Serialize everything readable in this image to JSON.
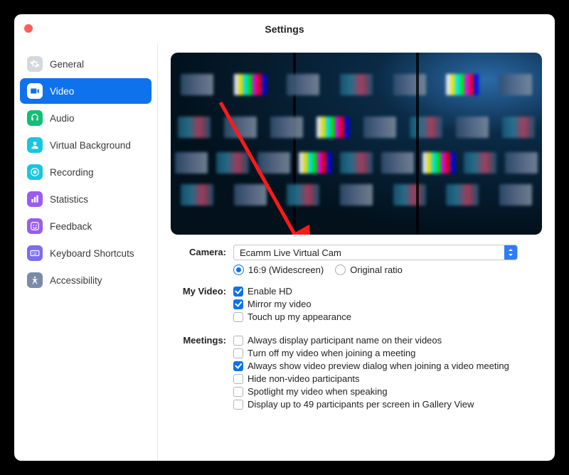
{
  "window": {
    "title": "Settings"
  },
  "sidebar": {
    "items": [
      {
        "label": "General",
        "icon": "gear",
        "bg": "#d5d8dc",
        "fg": "#fff"
      },
      {
        "label": "Video",
        "icon": "camera",
        "bg": "#ffffff",
        "fg": "#0e72ed",
        "active": true
      },
      {
        "label": "Audio",
        "icon": "headset",
        "bg": "#10c074",
        "fg": "#fff"
      },
      {
        "label": "Virtual Background",
        "icon": "user",
        "bg": "#18c6e0",
        "fg": "#fff"
      },
      {
        "label": "Recording",
        "icon": "record",
        "bg": "#18c6e0",
        "fg": "#fff"
      },
      {
        "label": "Statistics",
        "icon": "stats",
        "bg": "#9a5cf0",
        "fg": "#fff"
      },
      {
        "label": "Feedback",
        "icon": "smile",
        "bg": "#9a5cf0",
        "fg": "#fff"
      },
      {
        "label": "Keyboard Shortcuts",
        "icon": "keyboard",
        "bg": "#7b6cf0",
        "fg": "#fff"
      },
      {
        "label": "Accessibility",
        "icon": "access",
        "bg": "#7b8aa8",
        "fg": "#fff"
      }
    ]
  },
  "camera": {
    "label": "Camera:",
    "selected": "Ecamm Live Virtual Cam",
    "aspect_16_9": "16:9 (Widescreen)",
    "aspect_orig": "Original ratio"
  },
  "myvideo": {
    "label": "My Video:",
    "options": [
      {
        "label": "Enable HD",
        "checked": true
      },
      {
        "label": "Mirror my video",
        "checked": true
      },
      {
        "label": "Touch up my appearance",
        "checked": false
      }
    ]
  },
  "meetings": {
    "label": "Meetings:",
    "options": [
      {
        "label": "Always display participant name on their videos",
        "checked": false
      },
      {
        "label": "Turn off my video when joining a meeting",
        "checked": false
      },
      {
        "label": "Always show video preview dialog when joining a video meeting",
        "checked": true
      },
      {
        "label": "Hide non-video participants",
        "checked": false
      },
      {
        "label": "Spotlight my video when speaking",
        "checked": false
      },
      {
        "label": "Display up to 49 participants per screen in Gallery View",
        "checked": false
      }
    ]
  }
}
